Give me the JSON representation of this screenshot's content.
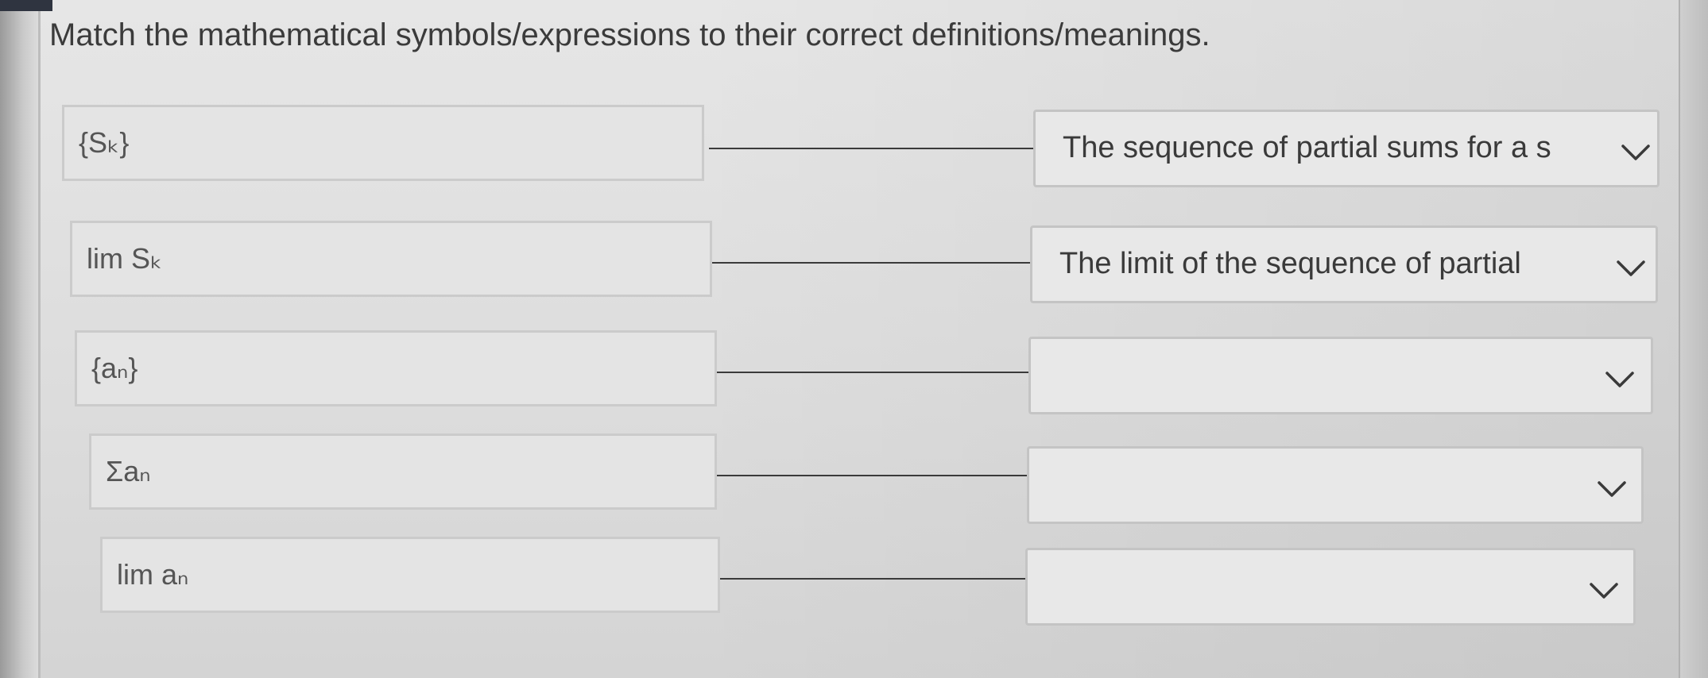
{
  "instruction": "Match the mathematical symbols/expressions to their correct definitions/meanings.",
  "rows": [
    {
      "term": "{Sₖ}",
      "answer": "The sequence of partial sums for a s"
    },
    {
      "term": "lim Sₖ",
      "answer": "The limit of the sequence of partial"
    },
    {
      "term": "{aₙ}",
      "answer": ""
    },
    {
      "term": "Σaₙ",
      "answer": ""
    },
    {
      "term": "lim aₙ",
      "answer": ""
    }
  ],
  "dropdown_icon": "chevron-down-icon"
}
